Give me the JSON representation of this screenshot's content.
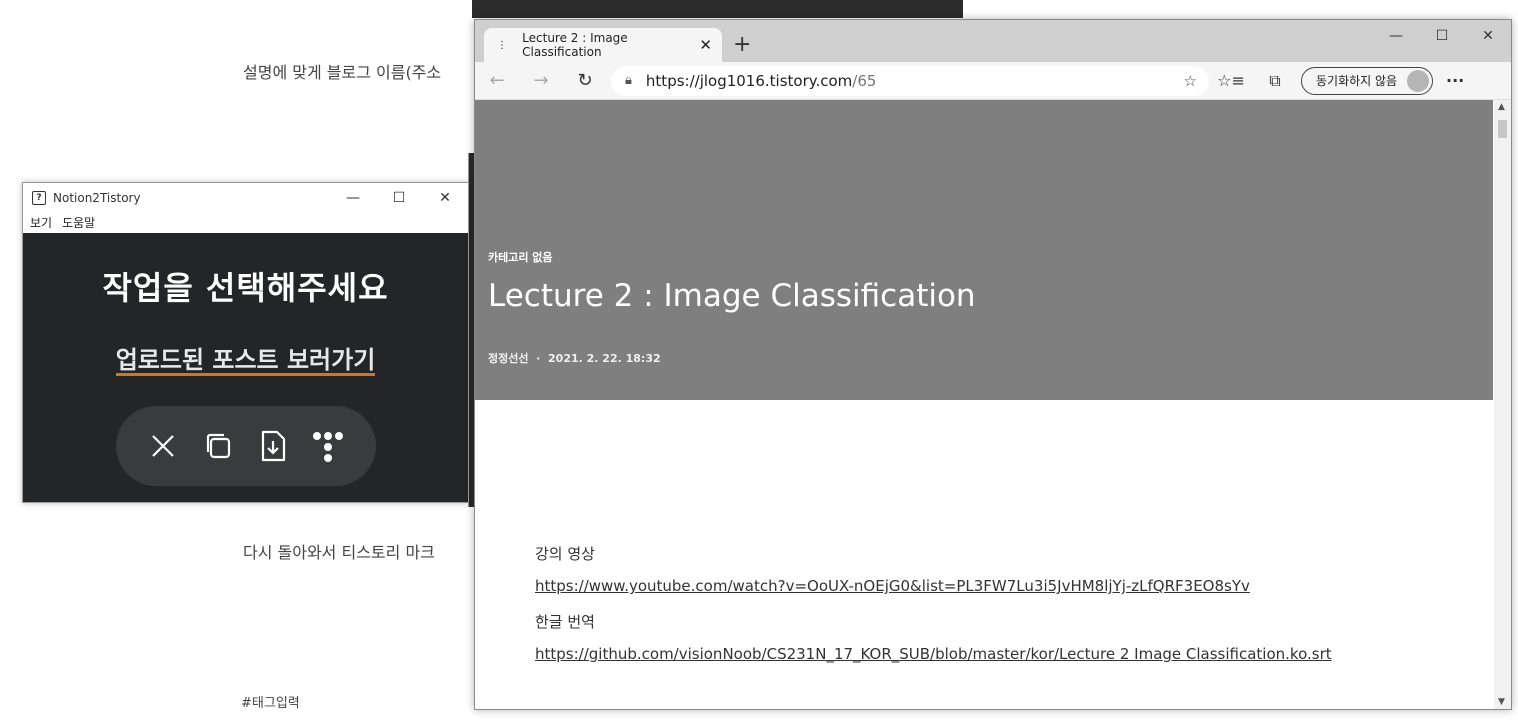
{
  "background": {
    "line1": "설명에 맞게 블로그 이름(주소",
    "line2": "다시 돌아와서 티스토리 마크",
    "tag": "#태그입력"
  },
  "n2t": {
    "title": "Notion2Tistory",
    "menu": [
      "보기",
      "도움말"
    ],
    "heading": "작업을 선택해주세요",
    "link": "업로드된 포스트 보러가기",
    "accent": "#d9741c"
  },
  "browser": {
    "tab_title": "Lecture 2 : Image Classification",
    "url_host": "https://jlog1016.tistory.com",
    "url_path": "/65",
    "sync_label": "동기화하지 않음"
  },
  "post": {
    "category": "카테고리 없음",
    "title": "Lecture 2 : Image Classification",
    "author": "정정선선",
    "date": "2021. 2. 22. 18:32",
    "lines": [
      "강의 영상",
      "https://www.youtube.com/watch?v=OoUX-nOEjG0&list=PL3FW7Lu3i5JvHM8ljYj-zLfQRF3EO8sYv",
      "한글 번역",
      "https://github.com/visionNoob/CS231N_17_KOR_SUB/blob/master/kor/Lecture 2 Image Classification.ko.srt"
    ]
  }
}
